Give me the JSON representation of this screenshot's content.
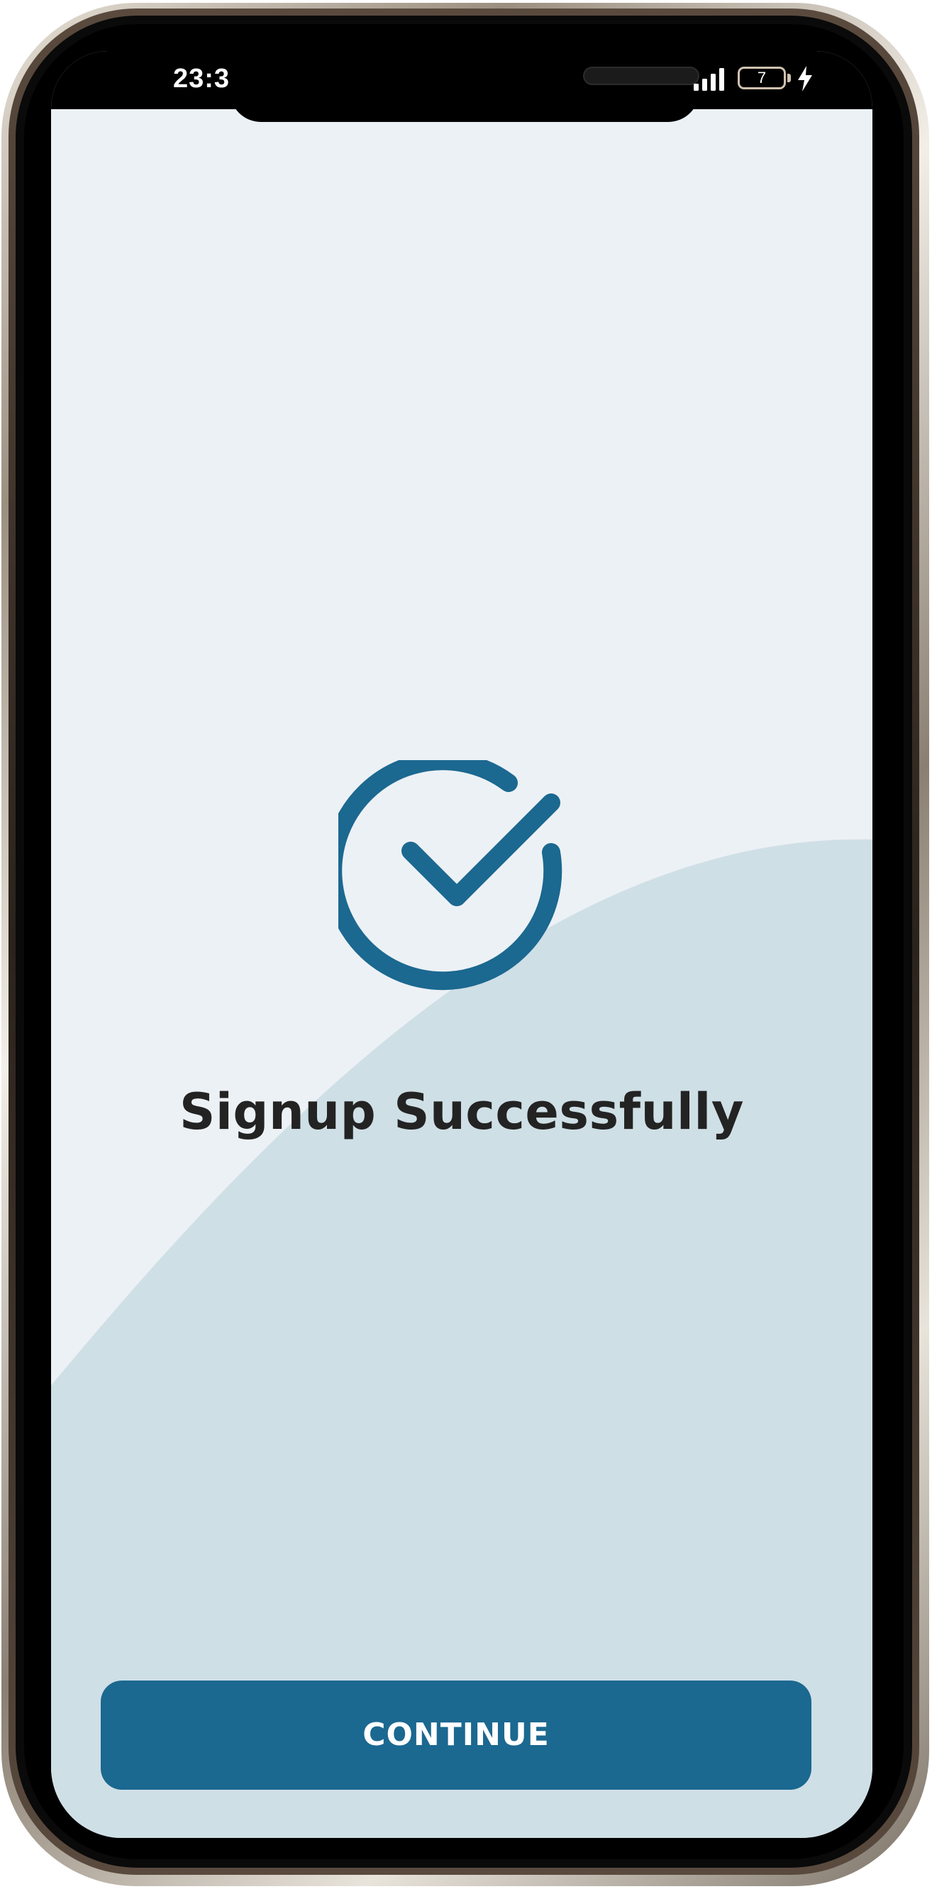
{
  "status_bar": {
    "time": "23:3",
    "battery_level": "7"
  },
  "main": {
    "title": "Signup Successfully",
    "continue_label": "CONTINUE"
  },
  "icons": {
    "status": "check-circle-icon",
    "signal": "signal-icon",
    "battery": "battery-icon",
    "charging": "charging-bolt-icon"
  },
  "colors": {
    "accent": "#1b6890",
    "background": "#ecf1f5",
    "wave": "#cfdfe6",
    "title": "#232323",
    "button_text": "#ffffff"
  }
}
